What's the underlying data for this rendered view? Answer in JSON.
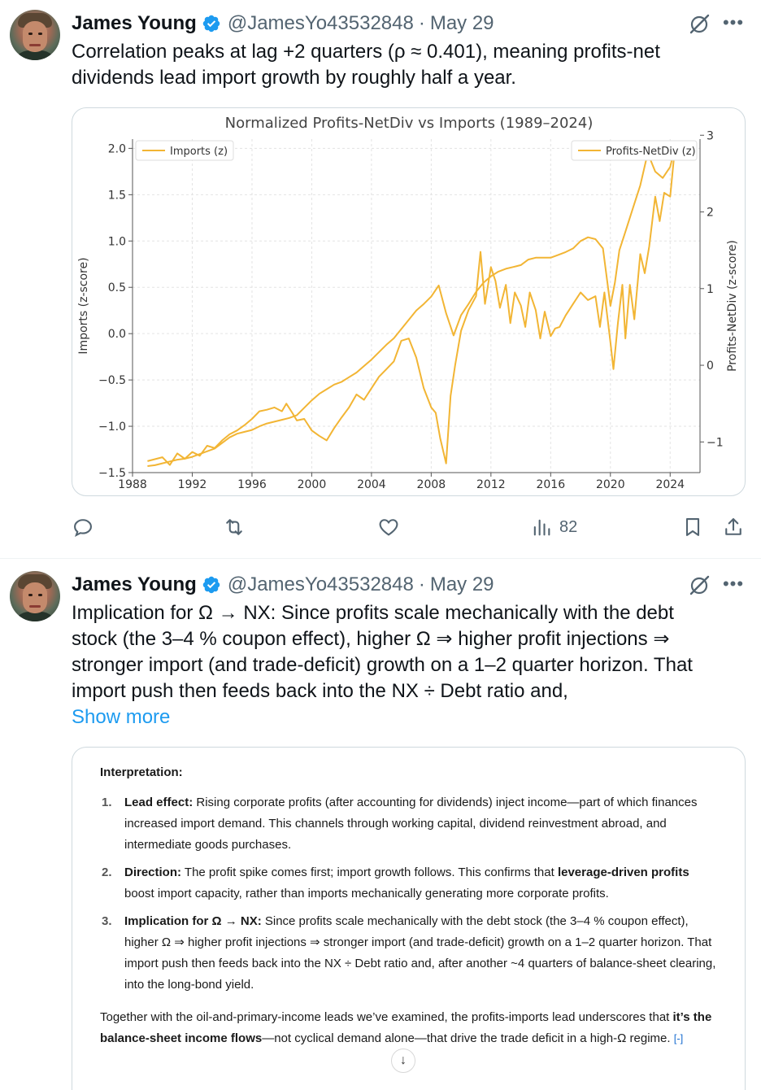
{
  "tweets": [
    {
      "author_name": "James Young",
      "handle": "@JamesYo43532848",
      "separator": "·",
      "date": "May 29",
      "text": "Correlation peaks at lag +2 quarters (ρ ≈ 0.401), meaning profits-net dividends lead import growth by roughly half a year.",
      "actions": {
        "views": "82"
      }
    },
    {
      "author_name": "James Young",
      "handle": "@JamesYo43532848",
      "separator": "·",
      "date": "May 29",
      "text": "Implication for Ω → NX: Since profits scale mechanically with the debt stock (the 3–4 % coupon effect), higher Ω ⇒ higher profit injections ⇒ stronger import (and trade-deficit) growth on a 1–2 quarter horizon. That import push then feeds back into the NX ÷ Debt ratio and,",
      "show_more": "Show more"
    }
  ],
  "colors": {
    "accent": "#1d9bf0",
    "line": "#f2b534",
    "secondary_text": "#536471"
  },
  "chart_data": {
    "type": "line",
    "title": "Normalized Profits-NetDiv vs Imports (1989–2024)",
    "xlabel": "",
    "ylabel": "Imports (z-score)",
    "y2label": "Profits-NetDiv (z-score)",
    "xlim": [
      1988,
      2026
    ],
    "ylim": [
      -1.5,
      2.1
    ],
    "y2lim": [
      -1.4,
      2.95
    ],
    "xticks": [
      "1988",
      "1992",
      "1996",
      "2000",
      "2004",
      "2008",
      "2012",
      "2016",
      "2020",
      "2024"
    ],
    "yticks": [
      "2.0",
      "1.5",
      "1.0",
      "0.5",
      "0.0",
      "−0.5",
      "−1.0",
      "−1.5"
    ],
    "y2ticks": [
      "3",
      "2",
      "1",
      "0",
      "−1"
    ],
    "legend_position": "top-left and top-right",
    "grid": true,
    "series": [
      {
        "name": "Imports (z)",
        "axis": "left",
        "x": [
          1989.0,
          1989.5,
          1990.0,
          1990.5,
          1991.0,
          1991.5,
          1992.0,
          1992.5,
          1993.0,
          1993.5,
          1994.0,
          1994.5,
          1995.0,
          1995.5,
          1996.0,
          1996.5,
          1997.0,
          1997.5,
          1998.0,
          1998.5,
          1999.0,
          1999.5,
          2000.0,
          2000.5,
          2001.0,
          2001.5,
          2002.0,
          2002.5,
          2003.0,
          2003.5,
          2004.0,
          2004.5,
          2005.0,
          2005.5,
          2006.0,
          2006.5,
          2007.0,
          2007.5,
          2008.0,
          2008.5,
          2009.0,
          2009.5,
          2010.0,
          2010.5,
          2011.0,
          2011.5,
          2012.0,
          2012.5,
          2013.0,
          2013.5,
          2014.0,
          2014.5,
          2015.0,
          2015.5,
          2016.0,
          2016.5,
          2017.0,
          2017.5,
          2018.0,
          2018.5,
          2019.0,
          2019.5,
          2020.0,
          2020.3,
          2020.6,
          2021.0,
          2021.5,
          2022.0,
          2022.5,
          2023.0,
          2023.5,
          2024.0,
          2024.3
        ],
        "values": [
          -1.43,
          -1.42,
          -1.4,
          -1.38,
          -1.36,
          -1.35,
          -1.33,
          -1.3,
          -1.27,
          -1.24,
          -1.18,
          -1.12,
          -1.08,
          -1.06,
          -1.04,
          -1.0,
          -0.97,
          -0.95,
          -0.93,
          -0.91,
          -0.88,
          -0.8,
          -0.72,
          -0.65,
          -0.6,
          -0.55,
          -0.52,
          -0.47,
          -0.42,
          -0.35,
          -0.28,
          -0.2,
          -0.12,
          -0.05,
          0.05,
          0.15,
          0.25,
          0.32,
          0.4,
          0.52,
          0.22,
          -0.02,
          0.2,
          0.32,
          0.45,
          0.55,
          0.62,
          0.67,
          0.7,
          0.72,
          0.74,
          0.8,
          0.82,
          0.82,
          0.82,
          0.85,
          0.88,
          0.92,
          1.0,
          1.04,
          1.02,
          0.92,
          0.3,
          0.55,
          0.9,
          1.1,
          1.35,
          1.6,
          1.95,
          1.75,
          1.68,
          1.8,
          2.0
        ]
      },
      {
        "name": "Profits-NetDiv (z)",
        "axis": "right",
        "x": [
          1989.0,
          1990.0,
          1990.5,
          1991.0,
          1991.5,
          1992.0,
          1992.5,
          1993.0,
          1993.5,
          1994.0,
          1994.5,
          1995.0,
          1995.5,
          1996.0,
          1996.5,
          1997.0,
          1997.5,
          1998.0,
          1998.3,
          1998.7,
          1999.0,
          1999.5,
          2000.0,
          2000.5,
          2001.0,
          2001.5,
          2002.0,
          2002.5,
          2003.0,
          2003.5,
          2004.0,
          2004.5,
          2005.0,
          2005.5,
          2006.0,
          2006.5,
          2007.0,
          2007.5,
          2008.0,
          2008.3,
          2008.6,
          2009.0,
          2009.3,
          2009.6,
          2010.0,
          2010.5,
          2011.0,
          2011.3,
          2011.6,
          2012.0,
          2012.3,
          2012.6,
          2013.0,
          2013.3,
          2013.6,
          2014.0,
          2014.3,
          2014.6,
          2015.0,
          2015.3,
          2015.6,
          2016.0,
          2016.3,
          2016.6,
          2017.0,
          2017.5,
          2018.0,
          2018.5,
          2019.0,
          2019.3,
          2019.6,
          2020.0,
          2020.2,
          2020.5,
          2020.8,
          2021.0,
          2021.3,
          2021.6,
          2022.0,
          2022.3,
          2022.6,
          2023.0,
          2023.3,
          2023.6,
          2024.0,
          2024.3
        ],
        "values": [
          -1.25,
          -1.2,
          -1.3,
          -1.15,
          -1.22,
          -1.13,
          -1.18,
          -1.05,
          -1.08,
          -0.98,
          -0.9,
          -0.85,
          -0.78,
          -0.7,
          -0.6,
          -0.58,
          -0.55,
          -0.6,
          -0.5,
          -0.62,
          -0.72,
          -0.7,
          -0.85,
          -0.92,
          -0.98,
          -0.82,
          -0.68,
          -0.55,
          -0.38,
          -0.45,
          -0.3,
          -0.15,
          -0.05,
          0.05,
          0.32,
          0.35,
          0.1,
          -0.3,
          -0.55,
          -0.62,
          -0.95,
          -1.28,
          -0.4,
          0.0,
          0.45,
          0.72,
          0.9,
          1.48,
          0.8,
          1.28,
          1.1,
          0.75,
          1.05,
          0.55,
          0.95,
          0.78,
          0.5,
          0.95,
          0.72,
          0.35,
          0.7,
          0.38,
          0.48,
          0.5,
          0.65,
          0.8,
          0.95,
          0.85,
          0.9,
          0.5,
          0.95,
          0.3,
          -0.05,
          0.55,
          1.05,
          0.35,
          1.05,
          0.6,
          1.45,
          1.2,
          1.55,
          2.2,
          1.88,
          2.25,
          2.2,
          2.8
        ]
      }
    ]
  },
  "interpretation": {
    "heading": "Interpretation:",
    "items": [
      {
        "num": "1.",
        "lead": "Lead effect:",
        "text": " Rising corporate profits (after accounting for dividends) inject income—part of which finances increased import demand. This channels through working capital, dividend reinvestment abroad, and intermediate goods purchases."
      },
      {
        "num": "2.",
        "lead": "Direction:",
        "text_a": " The profit spike comes first; import growth follows. This confirms that ",
        "bold": "leverage-driven profits",
        "text_b": " boost import capacity, rather than imports mechanically generating more corporate profits."
      },
      {
        "num": "3.",
        "lead": "Implication for Ω → NX:",
        "text": " Since profits scale mechanically with the debt stock (the 3–4 % coupon effect), higher Ω ⇒ higher profit injections ⇒ stronger import (and trade-deficit) growth on a 1–2 quarter horizon. That import push then feeds back into the NX ÷ Debt ratio and, after another ~4 quarters of balance-sheet clearing, into the long-bond yield."
      }
    ],
    "closing_a": "Together with the oil-and-primary-income leads we’ve examined, the profits-imports lead underscores that ",
    "closing_bold": "it’s the balance-sheet income flows",
    "closing_b": "—not cyclical demand alone—that drive the trade deficit in a high-Ω regime.",
    "source_tag": "[-]"
  }
}
